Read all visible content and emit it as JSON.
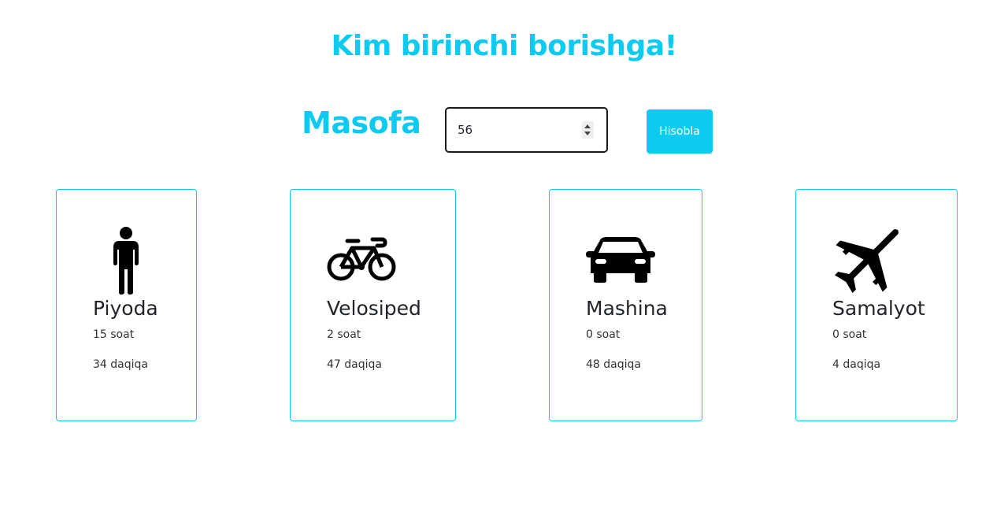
{
  "header": {
    "title": "Kim birinchi borishga!"
  },
  "form": {
    "label": "Masofa",
    "distance_value": "56",
    "button_label": "Hisobla"
  },
  "cards": [
    {
      "icon": "walking-person-icon",
      "title": "Piyoda",
      "hours": "15 soat",
      "minutes": "34 daqiqa"
    },
    {
      "icon": "bicycle-icon",
      "title": "Velosiped",
      "hours": "2 soat",
      "minutes": "47 daqiqa"
    },
    {
      "icon": "car-icon",
      "title": "Mashina",
      "hours": "0 soat",
      "minutes": "48 daqiqa"
    },
    {
      "icon": "airplane-icon",
      "title": "Samalyot",
      "hours": "0 soat",
      "minutes": "4 daqiqa"
    }
  ],
  "colors": {
    "accent": "#0dcaf0",
    "text": "#212529"
  }
}
